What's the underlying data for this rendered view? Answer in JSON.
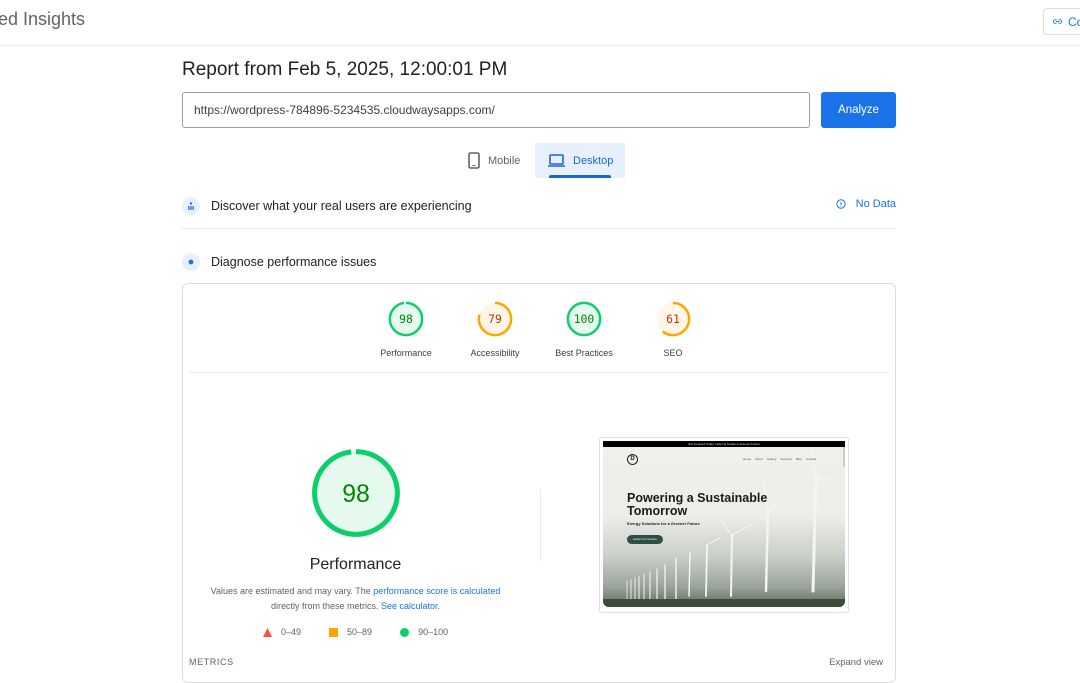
{
  "header": {
    "app_title": "ed Insights",
    "copy_link_label": "Co",
    "copy_link_icon": "link-icon"
  },
  "report": {
    "title": "Report from Feb 5, 2025, 12:00:01 PM",
    "url_value": "https://wordpress-784896-5234535.cloudwaysapps.com/",
    "analyze_label": "Analyze"
  },
  "device_tabs": [
    {
      "label": "Mobile",
      "icon": "smartphone-icon",
      "selected": false
    },
    {
      "label": "Desktop",
      "icon": "laptop-icon",
      "selected": true
    }
  ],
  "sections": {
    "discover": {
      "label": "Discover what your real users are experiencing",
      "status": "No Data",
      "status_icon": "info-icon"
    },
    "diagnose": {
      "label": "Diagnose performance issues"
    }
  },
  "categories": [
    {
      "label": "Performance",
      "score": 98,
      "rating": "good"
    },
    {
      "label": "Accessibility",
      "score": 79,
      "rating": "average"
    },
    {
      "label": "Best Practices",
      "score": 100,
      "rating": "good"
    },
    {
      "label": "SEO",
      "score": 61,
      "rating": "average"
    }
  ],
  "colors": {
    "good": "#0cce6b",
    "good_text": "#008800",
    "good_bg": "#e6f9ee",
    "average": "#ffa400",
    "average_text": "#c33300",
    "average_bg": "#fff6e8",
    "poor": "#ff4e42",
    "accent": "#1a73e8"
  },
  "performance_detail": {
    "score": 98,
    "title": "Performance",
    "note_prefix": "Values are estimated and may vary. The ",
    "note_link1": "performance score is calculated",
    "note_middle": " directly from these metrics. ",
    "note_link2": "See calculator.",
    "legend": [
      {
        "shape": "triangle",
        "range": "0–49"
      },
      {
        "shape": "square",
        "range": "50–89"
      },
      {
        "shape": "circle",
        "range": "90–100"
      }
    ]
  },
  "page_screenshot": {
    "banner": "Get Involved Today: Help Us Create A Greener Future",
    "logo": "D",
    "nav": [
      "Home",
      "About",
      "Gallery",
      "Services",
      "Blog",
      "Contact"
    ],
    "headline_line1": "Powering a Sustainable",
    "headline_line2": "Tomorrow",
    "subheadline": "Energy Solutions for a Greener Future",
    "cta": "Explore Our Services"
  },
  "metrics": {
    "label": "METRICS",
    "expand_label": "Expand view"
  }
}
